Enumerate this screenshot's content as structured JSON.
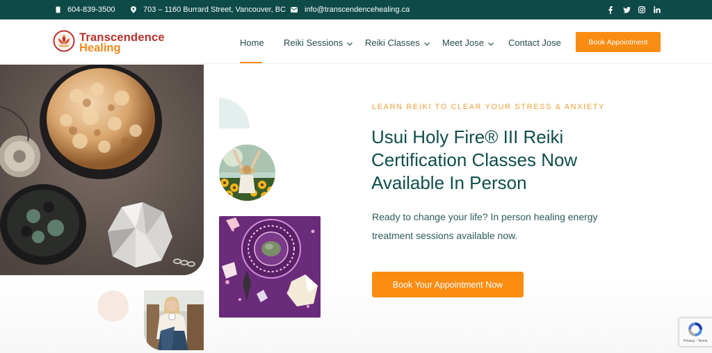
{
  "topbar": {
    "phone": "604-839-3500",
    "address": "703 – 1160 Burrard Street, Vancouver, BC",
    "email": "info@transcendencehealing.ca",
    "social": [
      "facebook-icon",
      "twitter-icon",
      "instagram-icon",
      "linkedin-icon"
    ]
  },
  "brand": {
    "name_line1": "Transcendence",
    "name_line2": "Healing",
    "colors": {
      "primary": "#0d4a48",
      "accent": "#f98c12",
      "logo_red": "#b8312a"
    }
  },
  "nav": {
    "items": [
      {
        "label": "Home",
        "active": true,
        "dropdown": false
      },
      {
        "label": "Reiki Sessions",
        "active": false,
        "dropdown": true
      },
      {
        "label": "Reiki Classes",
        "active": false,
        "dropdown": true
      },
      {
        "label": "Meet Jose",
        "active": false,
        "dropdown": true
      },
      {
        "label": "Contact Jose",
        "active": false,
        "dropdown": false
      }
    ],
    "cta_label": "Book Appointment"
  },
  "hero": {
    "eyebrow": "LEARN REIKI TO CLEAR YOUR STRESS & ANXIETY",
    "headline_line1": "Usui Holy Fire® III Reiki",
    "headline_line2": "Certification Classes Now",
    "headline_line3": "Available In Person",
    "subtext_line1": "Ready to change your life? In person healing energy",
    "subtext_line2": "treatment sessions available now.",
    "cta_label": "Book Your Appointment Now"
  },
  "recaptcha": {
    "text": "Privacy - Terms"
  }
}
